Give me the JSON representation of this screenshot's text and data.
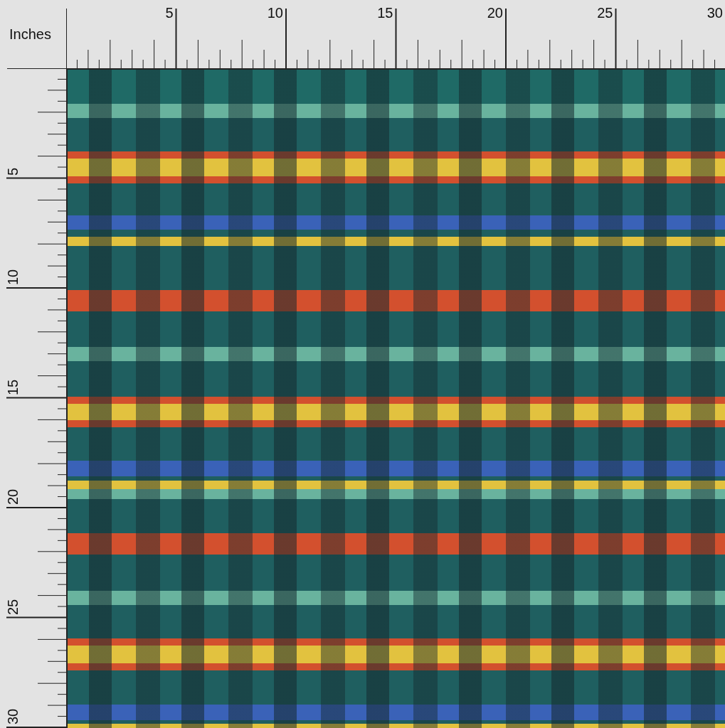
{
  "corner_label": "Inches",
  "top_ruler": {
    "labels": [
      "5",
      "10",
      "15",
      "20",
      "25",
      "30"
    ]
  },
  "left_ruler": {
    "labels": [
      "5",
      "10",
      "15",
      "20",
      "25",
      "30"
    ]
  }
}
